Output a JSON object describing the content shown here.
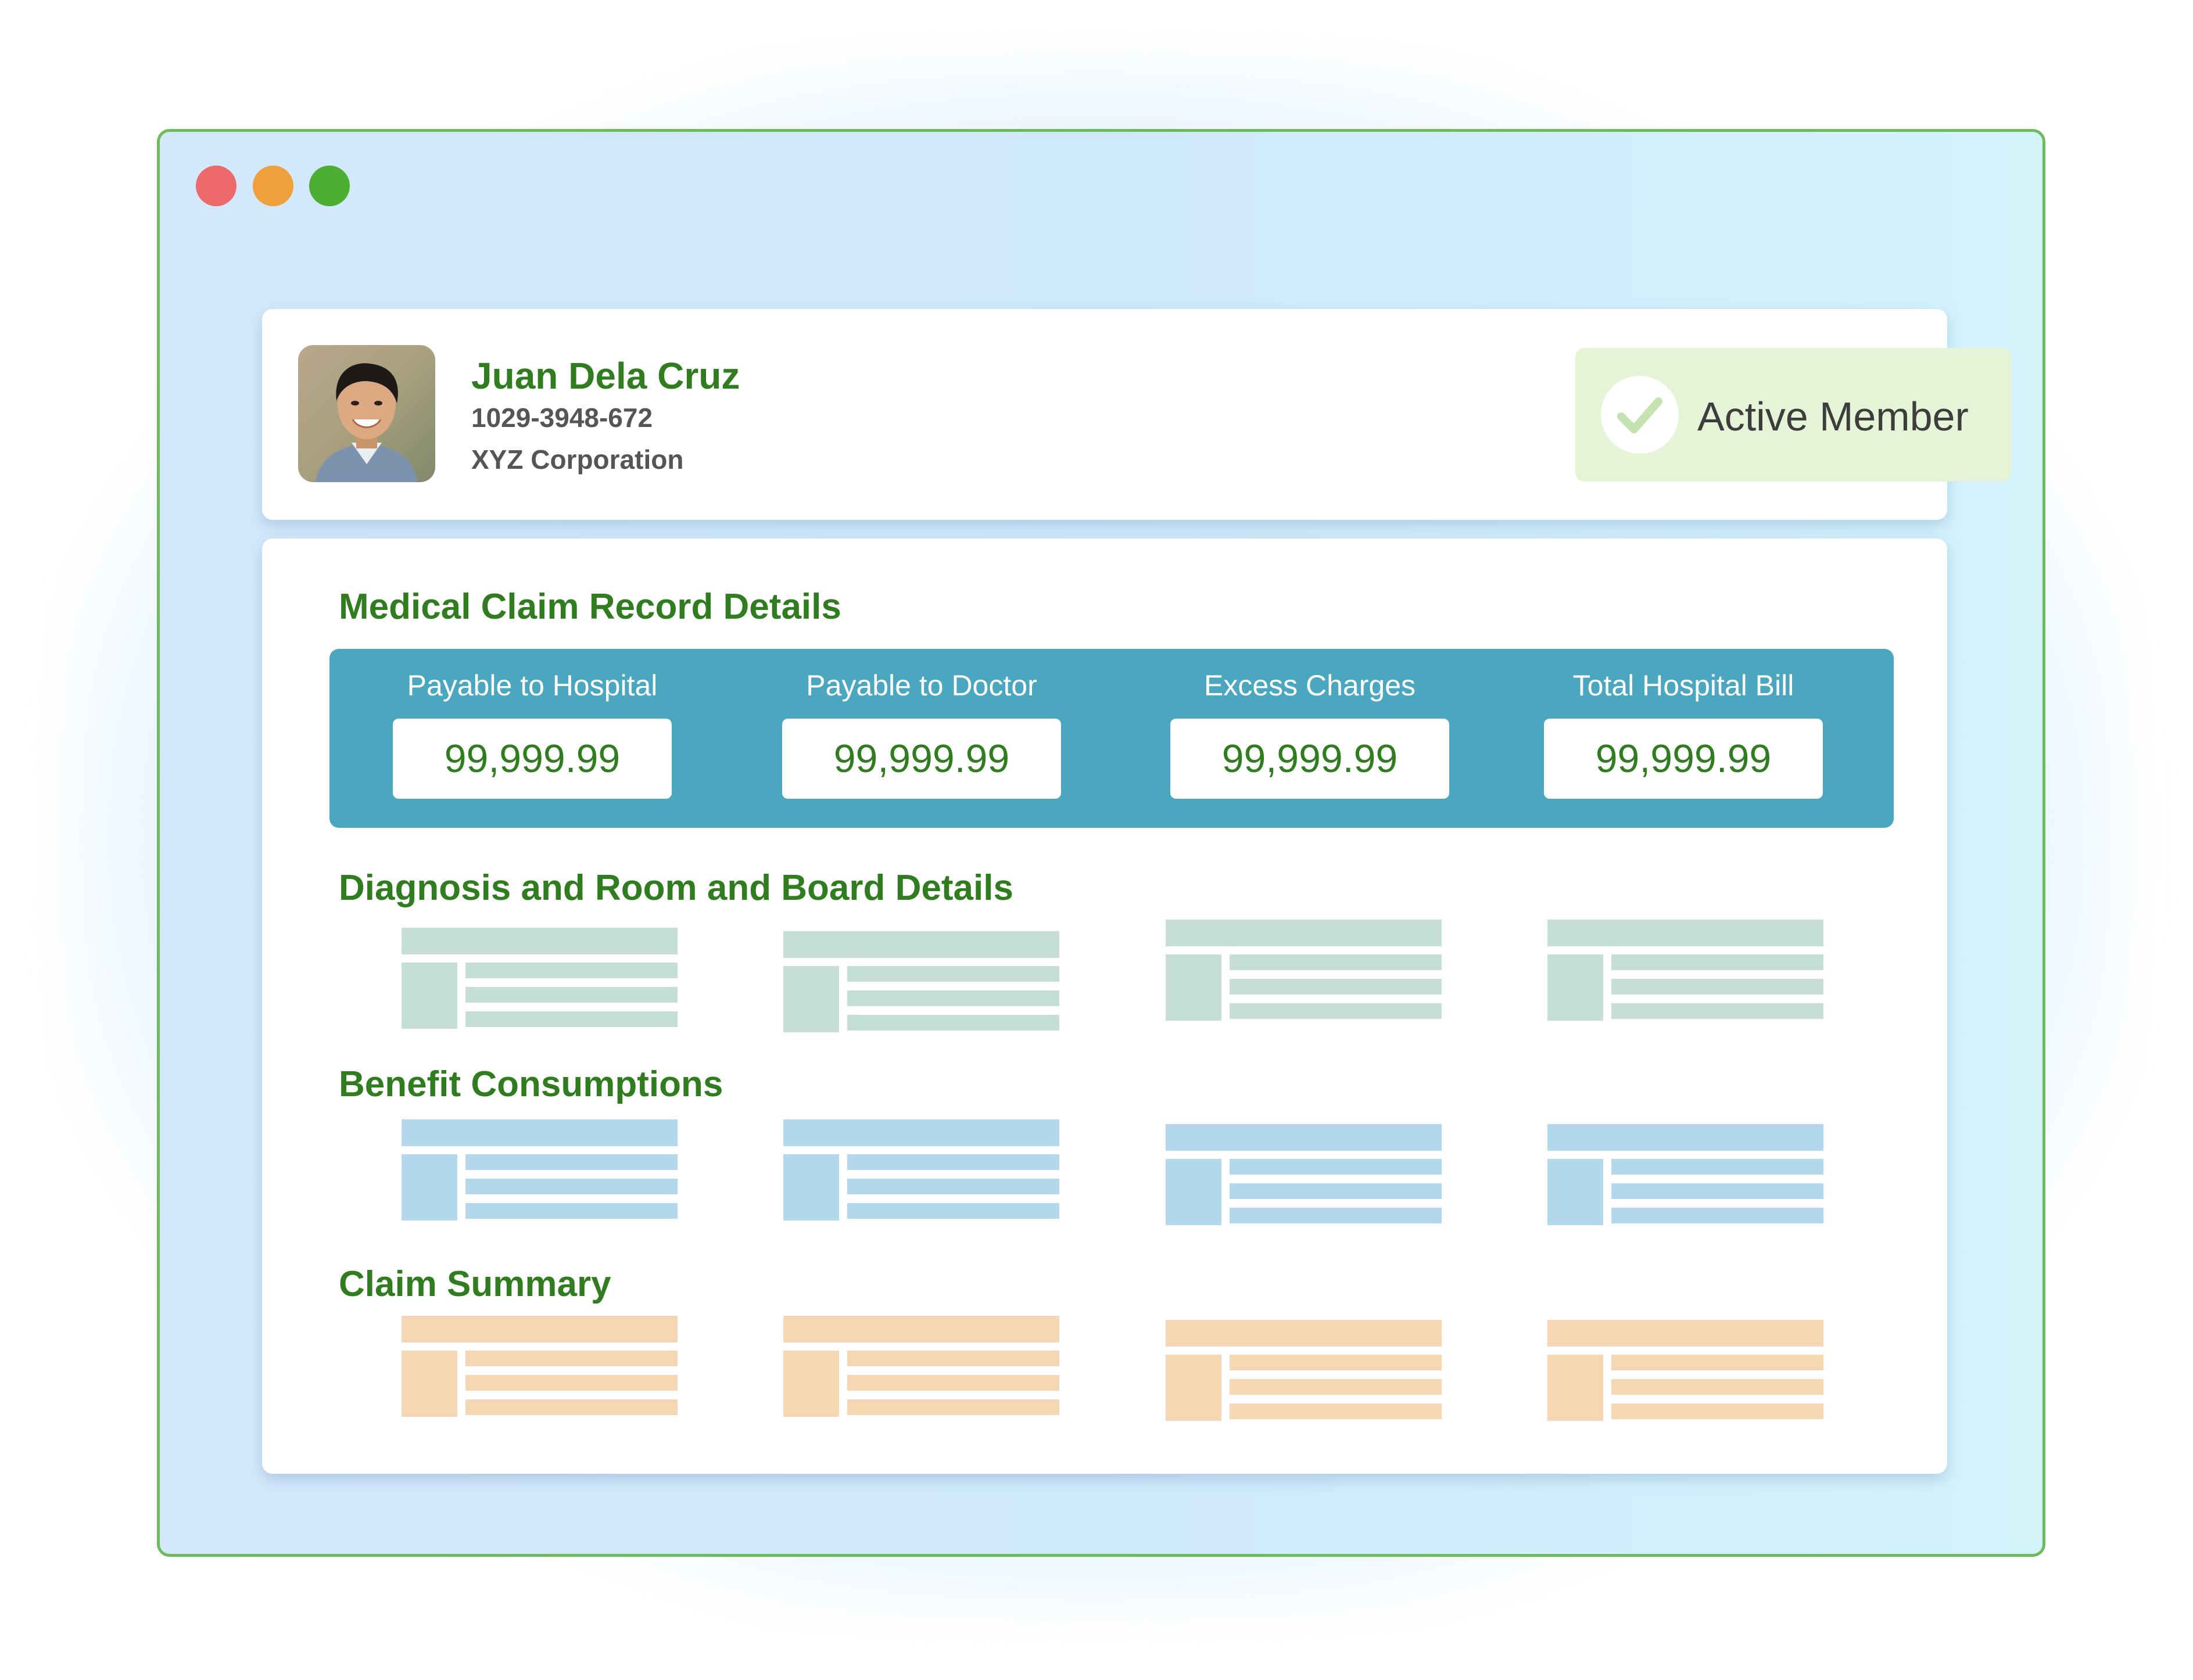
{
  "window": {
    "controls": [
      "close",
      "minimize",
      "maximize"
    ],
    "border_color": "#6dbb5a"
  },
  "member": {
    "name": "Juan Dela Cruz",
    "id_number": "1029-3948-672",
    "company": "XYZ Corporation",
    "status": "Active Member",
    "status_icon": "check-circle-icon"
  },
  "claim_record": {
    "title": "Medical Claim Record Details",
    "amounts": [
      {
        "label": "Payable to Hospital",
        "value": "99,999.99"
      },
      {
        "label": "Payable to Doctor",
        "value": "99,999.99"
      },
      {
        "label": "Excess Charges",
        "value": "99,999.99"
      },
      {
        "label": "Total Hospital Bill",
        "value": "99,999.99"
      }
    ]
  },
  "sections": [
    {
      "title": "Diagnosis and Room and Board Details",
      "color": "#c5dfd5"
    },
    {
      "title": "Benefit Consumptions",
      "color": "#b3d8ec"
    },
    {
      "title": "Claim Summary",
      "color": "#f6d7b4"
    }
  ],
  "colors": {
    "accent_green": "#2f7d1e",
    "panel_teal": "#4aa7bf",
    "badge_bg": "#e5f3d6"
  }
}
